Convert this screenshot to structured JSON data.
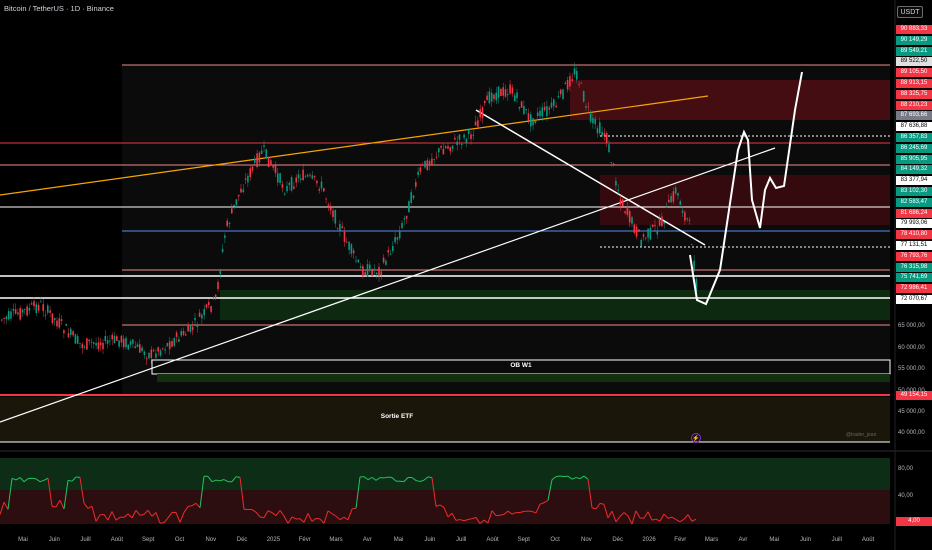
{
  "header": {
    "title": "Bitcoin / TetherUS · 1D · Binance"
  },
  "currency": "USDT",
  "price_labels": [
    {
      "text": "90 883,33",
      "bg": "#f23645",
      "fg": "#ffffff"
    },
    {
      "text": "90 149,29",
      "bg": "#089981",
      "fg": "#ffffff"
    },
    {
      "text": "89 549,21",
      "bg": "#089981",
      "fg": "#ffffff"
    },
    {
      "text": "89 522,50",
      "bg": "#e0e0e0",
      "fg": "#000000"
    },
    {
      "text": "89 105,50",
      "bg": "#f23645",
      "fg": "#ffffff"
    },
    {
      "text": "88 913,15",
      "bg": "#f23645",
      "fg": "#ffffff"
    },
    {
      "text": "88 325,75",
      "bg": "#f23645",
      "fg": "#ffffff"
    },
    {
      "text": "88 210,23",
      "bg": "#f23645",
      "fg": "#ffffff"
    },
    {
      "text": "87 693,66",
      "bg": "#787b86",
      "fg": "#ffffff"
    },
    {
      "text": "87 636,88",
      "bg": "#ffffff",
      "fg": "#000000"
    },
    {
      "text": "86 357,83",
      "bg": "#089981",
      "fg": "#ffffff"
    },
    {
      "text": "86 245,69",
      "bg": "#089981",
      "fg": "#ffffff"
    },
    {
      "text": "85 905,95",
      "bg": "#089981",
      "fg": "#ffffff"
    },
    {
      "text": "84 149,32",
      "bg": "#089981",
      "fg": "#ffffff"
    },
    {
      "text": "83 377,94",
      "bg": "#ffffff",
      "fg": "#000000"
    },
    {
      "text": "83 102,30",
      "bg": "#089981",
      "fg": "#ffffff"
    },
    {
      "text": "82 583,47",
      "bg": "#089981",
      "fg": "#ffffff"
    },
    {
      "text": "81 686,24",
      "bg": "#f23645",
      "fg": "#ffffff"
    },
    {
      "text": "79 993,06",
      "bg": "#ffffff",
      "fg": "#000000"
    },
    {
      "text": "78 410,80",
      "bg": "#f23645",
      "fg": "#ffffff"
    },
    {
      "text": "77 131,51",
      "bg": "#ffffff",
      "fg": "#000000"
    },
    {
      "text": "76 793,76",
      "bg": "#f23645",
      "fg": "#ffffff"
    },
    {
      "text": "76 315,98",
      "bg": "#089981",
      "fg": "#ffffff"
    },
    {
      "text": "75 741,69",
      "bg": "#089981",
      "fg": "#ffffff"
    },
    {
      "text": "72 986,41",
      "bg": "#f23645",
      "fg": "#ffffff"
    },
    {
      "text": "72 070,67",
      "bg": "#ffffff",
      "fg": "#000000"
    }
  ],
  "price_ticks": [
    "65 000,00",
    "60 000,00",
    "55 000,00",
    "50 000,00",
    "45 000,00",
    "40 000,00"
  ],
  "etf_label": "49 154,15",
  "zones": {
    "ob": "OB W1",
    "etf": "Sortie ETF"
  },
  "watermark": "@trader_jean",
  "oscillator": {
    "levels": [
      "80,00",
      "40,00"
    ],
    "current": "4,00"
  },
  "time_axis": [
    "Mai",
    "Juin",
    "Juill",
    "Août",
    "Sept",
    "Oct",
    "Nov",
    "Déc",
    "2025",
    "Févr",
    "Mars",
    "Avr",
    "Mai",
    "Juin",
    "Juill",
    "Août",
    "Sept",
    "Oct",
    "Nov",
    "Déc",
    "2026",
    "Févr",
    "Mars",
    "Avr",
    "Mai",
    "Juin",
    "Juill",
    "Août"
  ],
  "colors": {
    "bull": "#089981",
    "bear": "#f23645",
    "accent": "#f7a600",
    "fill": "#c4c6c9"
  }
}
